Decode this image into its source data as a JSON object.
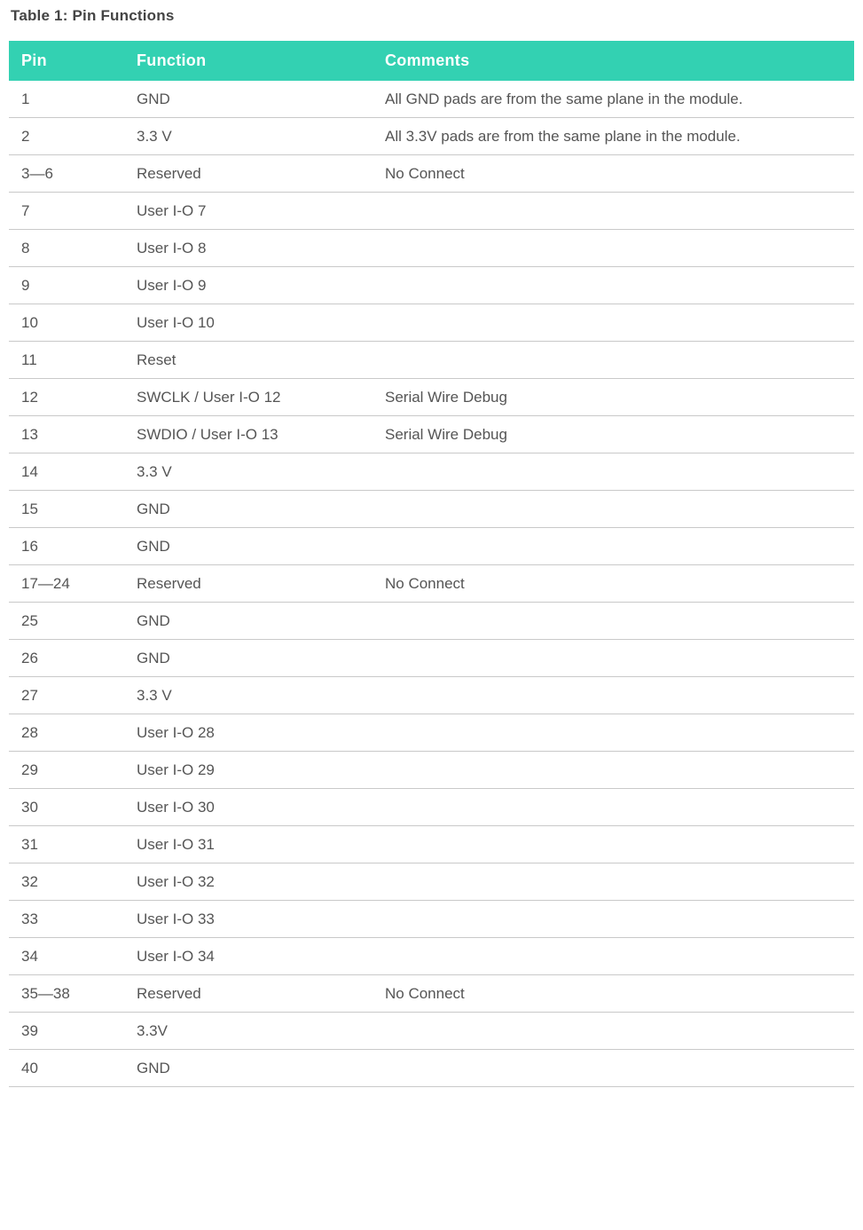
{
  "caption": "Table 1: Pin Functions",
  "headers": {
    "pin": "Pin",
    "function": "Function",
    "comments": "Comments"
  },
  "rows": [
    {
      "pin": "1",
      "function": "GND",
      "comments": "All GND pads are from the same plane in the module."
    },
    {
      "pin": "2",
      "function": "3.3 V",
      "comments": "All 3.3V pads are from the same plane in the module."
    },
    {
      "pin": "3—6",
      "function": "Reserved",
      "comments": "No Connect"
    },
    {
      "pin": "7",
      "function": "User I-O 7",
      "comments": ""
    },
    {
      "pin": "8",
      "function": "User I-O 8",
      "comments": ""
    },
    {
      "pin": "9",
      "function": "User I-O 9",
      "comments": ""
    },
    {
      "pin": "10",
      "function": "User I-O 10",
      "comments": ""
    },
    {
      "pin": "11",
      "function": "Reset",
      "comments": ""
    },
    {
      "pin": "12",
      "function": "SWCLK / User I-O 12",
      "comments": "Serial Wire Debug"
    },
    {
      "pin": "13",
      "function": "SWDIO / User I-O 13",
      "comments": "Serial Wire Debug"
    },
    {
      "pin": "14",
      "function": "3.3 V",
      "comments": ""
    },
    {
      "pin": "15",
      "function": "GND",
      "comments": ""
    },
    {
      "pin": "16",
      "function": "GND",
      "comments": ""
    },
    {
      "pin": "17—24",
      "function": "Reserved",
      "comments": "No Connect"
    },
    {
      "pin": "25",
      "function": "GND",
      "comments": ""
    },
    {
      "pin": "26",
      "function": "GND",
      "comments": ""
    },
    {
      "pin": "27",
      "function": "3.3 V",
      "comments": ""
    },
    {
      "pin": "28",
      "function": "User I-O 28",
      "comments": ""
    },
    {
      "pin": "29",
      "function": "User I-O 29",
      "comments": ""
    },
    {
      "pin": "30",
      "function": "User I-O 30",
      "comments": ""
    },
    {
      "pin": "31",
      "function": "User I-O 31",
      "comments": ""
    },
    {
      "pin": "32",
      "function": "User I-O 32",
      "comments": ""
    },
    {
      "pin": "33",
      "function": "User I-O 33",
      "comments": ""
    },
    {
      "pin": "34",
      "function": "User I-O 34",
      "comments": ""
    },
    {
      "pin": "35—38",
      "function": "Reserved",
      "comments": "No Connect"
    },
    {
      "pin": "39",
      "function": "3.3V",
      "comments": ""
    },
    {
      "pin": "40",
      "function": "GND",
      "comments": ""
    }
  ]
}
